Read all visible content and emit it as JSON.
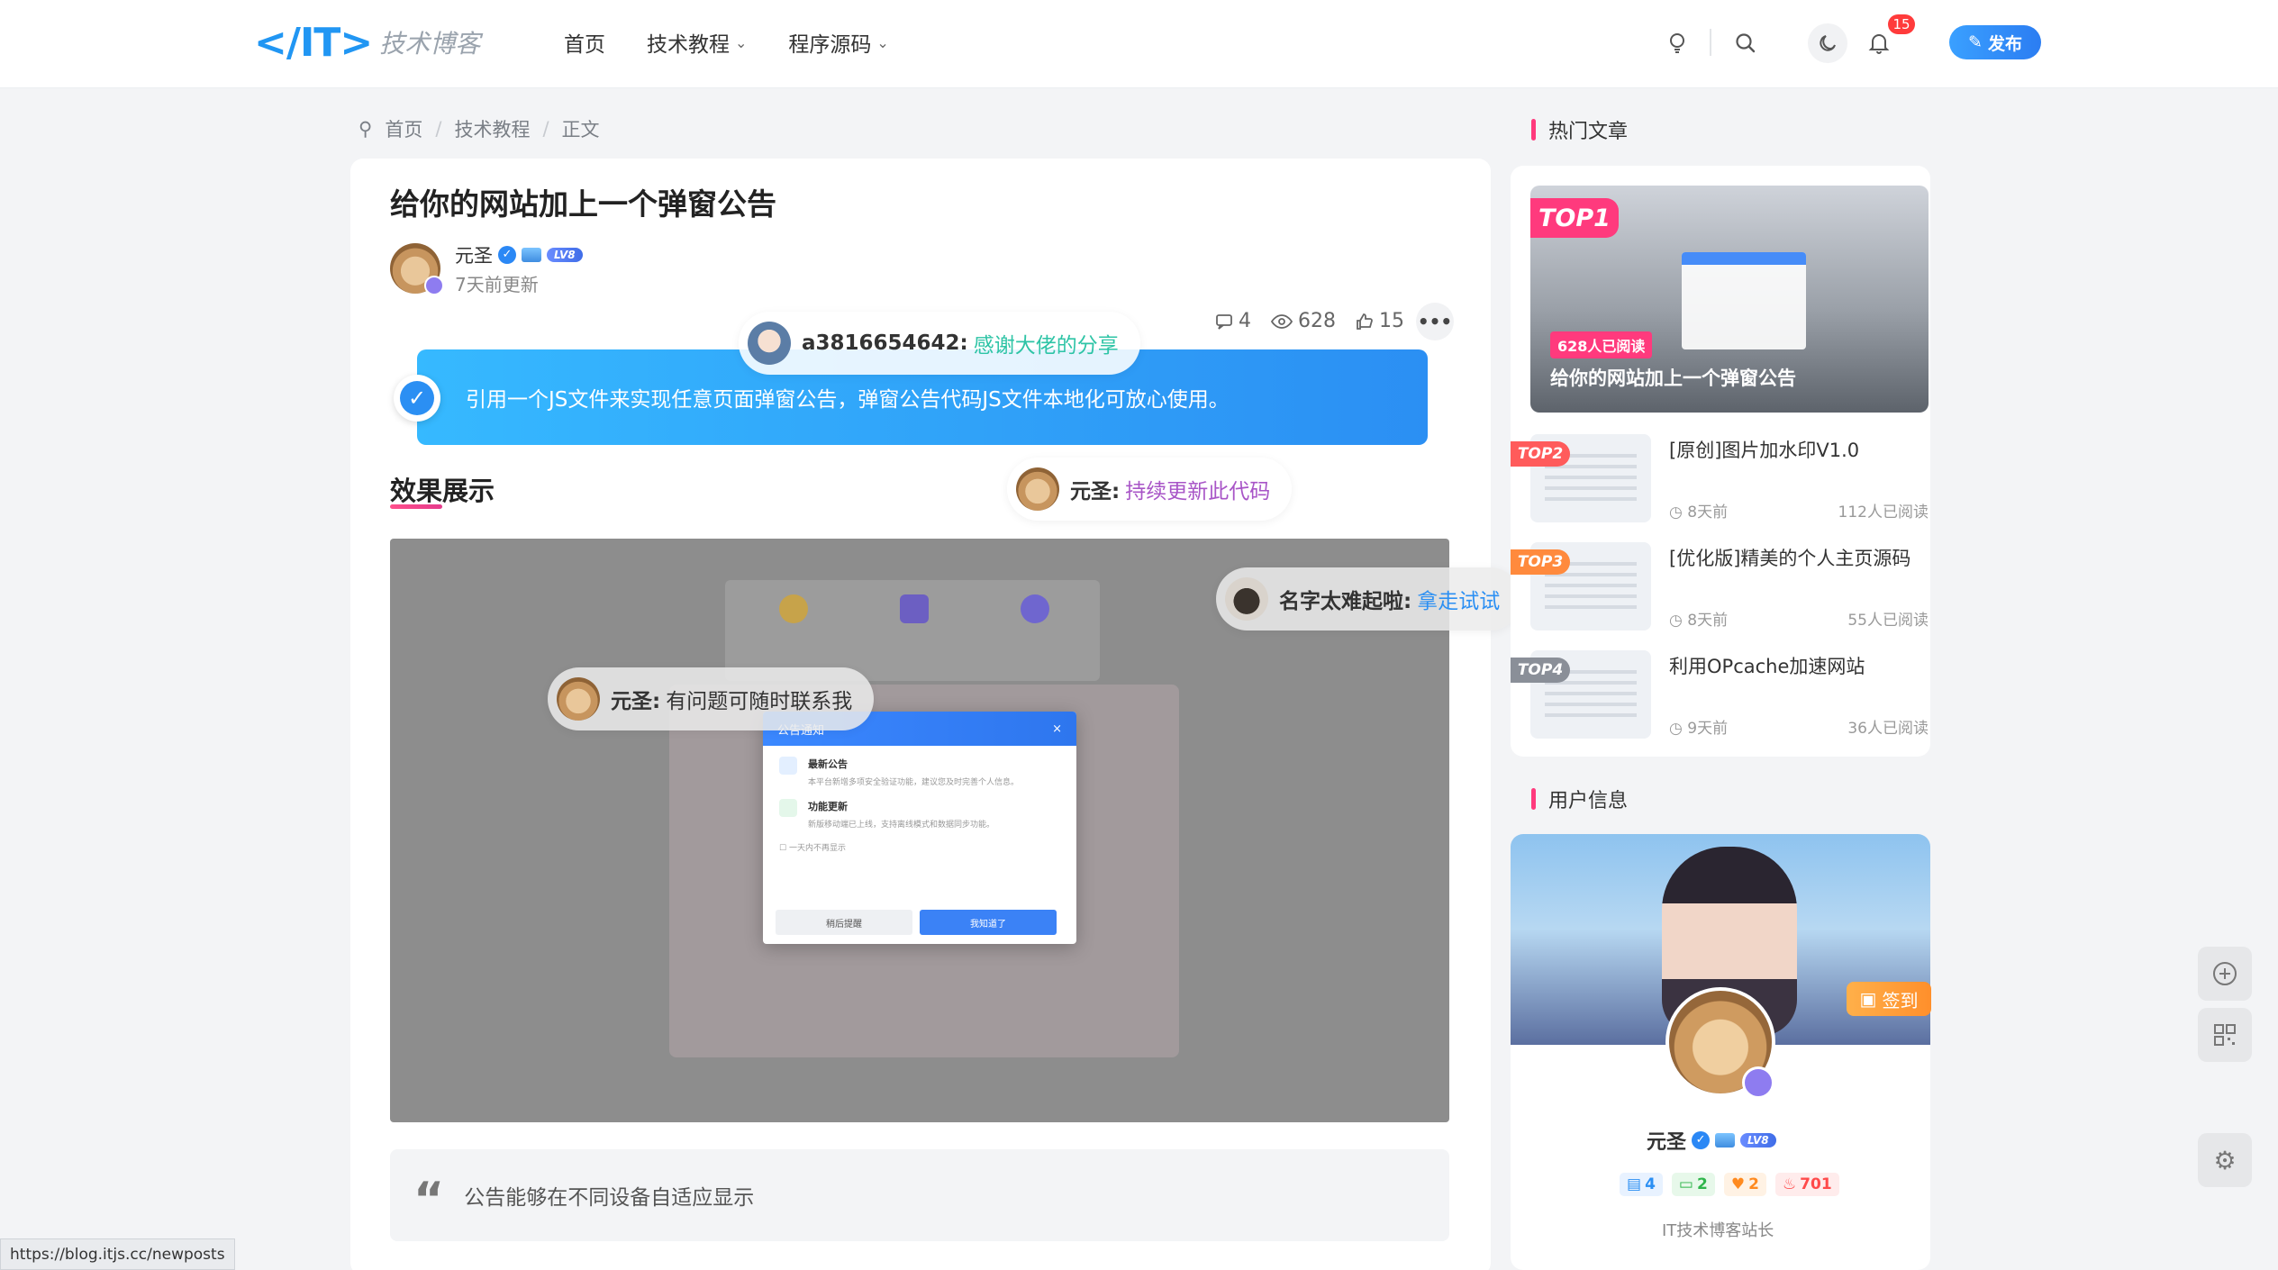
{
  "header": {
    "logo_mark": "</IT>",
    "logo_sub": "技术博客",
    "nav": [
      {
        "label": "首页"
      },
      {
        "label": "技术教程"
      },
      {
        "label": "程序源码"
      }
    ],
    "notification_count": "15",
    "publish_label": "发布"
  },
  "breadcrumb": {
    "items": [
      "首页",
      "技术教程",
      "正文"
    ]
  },
  "article": {
    "title": "给你的网站加上一个弹窗公告",
    "author": "元圣",
    "level": "LV8",
    "updated": "7天前更新",
    "comments": "4",
    "views": "628",
    "likes": "15",
    "summary": "引用一个JS文件来实现任意页面弹窗公告，弹窗公告代码JS文件本地化可放心使用。",
    "section_heading": "效果展示",
    "quote": "公告能够在不同设备自适应显示"
  },
  "preview_modal": {
    "title": "公告通知",
    "close": "×",
    "items": [
      {
        "title": "最新公告",
        "desc": "本平台新增多项安全验证功能，建议您及时完善个人信息。"
      },
      {
        "title": "功能更新",
        "desc": "新版移动端已上线，支持离线模式和数据同步功能。"
      }
    ],
    "checkbox": "一天内不再显示",
    "btn_later": "稍后提醒",
    "btn_ok": "我知道了"
  },
  "danmaku": [
    {
      "user": "a3816654642:",
      "msg": "感谢大佬的分享",
      "color": "#2ec4a6"
    },
    {
      "user": "元圣:",
      "msg": "持续更新此代码",
      "color": "#a855c7"
    },
    {
      "user": "名字太难起啦:",
      "msg": "拿走试试",
      "color": "#2b8ff3"
    },
    {
      "user": "元圣:",
      "msg": "有问题可随时联系我",
      "color": "#333333"
    }
  ],
  "sidebar": {
    "hot_heading": "热门文章",
    "top1": {
      "tag": "TOP1",
      "reads": "628人已阅读",
      "title": "给你的网站加上一个弹窗公告"
    },
    "tops": [
      {
        "tag": "TOP2",
        "title": "[原创]图片加水印V1.0",
        "time": "8天前",
        "reads": "112人已阅读"
      },
      {
        "tag": "TOP3",
        "title": "[优化版]精美的个人主页源码",
        "time": "8天前",
        "reads": "55人已阅读"
      },
      {
        "tag": "TOP4",
        "title": "利用OPcache加速网站",
        "time": "9天前",
        "reads": "36人已阅读"
      }
    ],
    "user_heading": "用户信息",
    "checkin_label": "签到",
    "user_name": "元圣",
    "user_level": "LV8",
    "user_stats": {
      "posts": "4",
      "comments": "2",
      "likes": "2",
      "hot": "701"
    },
    "user_role": "IT技术博客站长"
  },
  "status_url": "https://blog.itjs.cc/newposts",
  "colors": {
    "accent": "#2b8ff3",
    "pink": "#ff3a7d",
    "top1": "#ff3a7d",
    "top2": "#ff5b5b",
    "top3": "#ff8a3d",
    "top4": "#8a8f98"
  }
}
